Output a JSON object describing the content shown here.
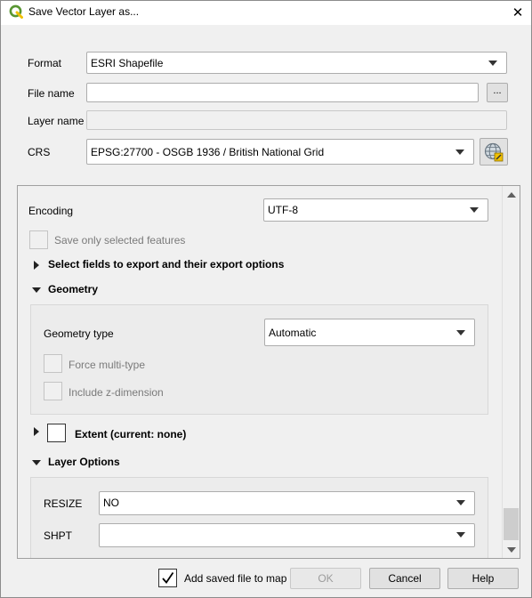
{
  "window": {
    "title": "Save Vector Layer as...",
    "close_glyph": "✕"
  },
  "form": {
    "format_label": "Format",
    "format_value": "ESRI Shapefile",
    "filename_label": "File name",
    "filename_value": "",
    "browse_label": "...",
    "layername_label": "Layer name",
    "layername_value": "",
    "crs_label": "CRS",
    "crs_value": "EPSG:27700 - OSGB 1936 / British National Grid"
  },
  "options": {
    "encoding_label": "Encoding",
    "encoding_value": "UTF-8",
    "save_selected_label": "Save only selected features",
    "select_fields_label": "Select fields to export and their export options",
    "geometry_label": "Geometry",
    "geometry_type_label": "Geometry type",
    "geometry_type_value": "Automatic",
    "force_multi_label": "Force multi-type",
    "include_z_label": "Include z-dimension",
    "extent_label": "Extent (current: none)",
    "layer_options_label": "Layer Options",
    "resize_label": "RESIZE",
    "resize_value": "NO",
    "shpt_label": "SHPT",
    "shpt_value": ""
  },
  "footer": {
    "add_to_map_label": "Add saved file to map",
    "add_to_map_checked": true,
    "ok_label": "OK",
    "cancel_label": "Cancel",
    "help_label": "Help"
  },
  "colors": {
    "qgis_green": "#589632",
    "qgis_yellow": "#f0c000"
  }
}
